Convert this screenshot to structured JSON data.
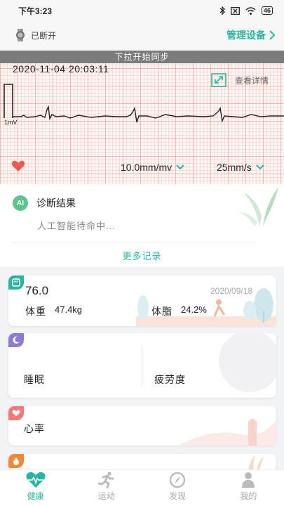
{
  "status_bar": {
    "time": "下午3:23",
    "battery": "46"
  },
  "device": {
    "connection": "已断开",
    "manage_label": "管理设备"
  },
  "ecg": {
    "sync_banner": "下拉开始同步",
    "timestamp": "2020-11-04 20:03:11",
    "detail_label": "查看详情",
    "scale_label": "1mV",
    "gain": "10.0mm/mv",
    "speed": "25mm/s"
  },
  "diagnosis": {
    "badge": "AI",
    "title": "诊断结果",
    "status": "人工智能待命中...",
    "more_label": "更多记录"
  },
  "body_card": {
    "score": "76.0",
    "date": "2020/09/18",
    "weight_label": "体重",
    "weight_value": "47.4kg",
    "fat_label": "体脂",
    "fat_value": "24.2%"
  },
  "sleep_card": {
    "sleep_label": "睡眠",
    "fatigue_label": "疲劳度"
  },
  "heart_card": {
    "label": "心率"
  },
  "tabs": [
    {
      "label": "健康",
      "icon": "heart-pulse-icon",
      "active": true
    },
    {
      "label": "运动",
      "icon": "running-icon",
      "active": false
    },
    {
      "label": "发现",
      "icon": "compass-icon",
      "active": false
    },
    {
      "label": "我的",
      "icon": "person-icon",
      "active": false
    }
  ],
  "colors": {
    "accent": "#2bb5a0",
    "heart": "#e85a4f",
    "ecg_grid": "#f0968c",
    "sleep_tag": "#8e7ad6",
    "body_tag": "#2bb5a0",
    "heart_tag": "#f07a7a",
    "water_tag": "#f0883a"
  }
}
